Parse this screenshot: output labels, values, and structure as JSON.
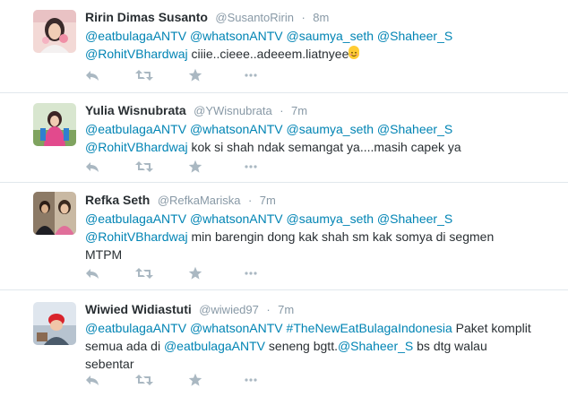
{
  "tweets": [
    {
      "fullname": "Ririn Dimas Susanto",
      "username": "@SusantoRirin",
      "sep": "·",
      "time": "8m",
      "line1": [
        {
          "text": "@eatbulagaANTV",
          "mention": true
        },
        {
          "text": " ",
          "mention": false
        },
        {
          "text": "@whatsonANTV",
          "mention": true
        },
        {
          "text": " ",
          "mention": false
        },
        {
          "text": "@saumya_seth",
          "mention": true
        },
        {
          "text": " ",
          "mention": false
        },
        {
          "text": "@Shaheer_S",
          "mention": true
        }
      ],
      "line2": [
        {
          "text": "@RohitVBhardwaj",
          "mention": true
        },
        {
          "text": " ciiie..cieee..adeeem.liatnyee",
          "mention": false
        }
      ],
      "emoji": "smiling-face-emoji"
    },
    {
      "fullname": "Yulia Wisnubrata",
      "username": "@YWisnubrata",
      "sep": "·",
      "time": "7m",
      "line1": [
        {
          "text": "@eatbulagaANTV",
          "mention": true
        },
        {
          "text": " ",
          "mention": false
        },
        {
          "text": "@whatsonANTV",
          "mention": true
        },
        {
          "text": " ",
          "mention": false
        },
        {
          "text": "@saumya_seth",
          "mention": true
        },
        {
          "text": " ",
          "mention": false
        },
        {
          "text": "@Shaheer_S",
          "mention": true
        }
      ],
      "line2": [
        {
          "text": "@RohitVBhardwaj",
          "mention": true
        },
        {
          "text": " kok si shah ndak semangat ya....masih capek ya",
          "mention": false
        }
      ]
    },
    {
      "fullname": "Refka Seth",
      "username": "@RefkaMariska",
      "sep": "·",
      "time": "7m",
      "line1": [
        {
          "text": "@eatbulagaANTV",
          "mention": true
        },
        {
          "text": " ",
          "mention": false
        },
        {
          "text": "@whatsonANTV",
          "mention": true
        },
        {
          "text": " ",
          "mention": false
        },
        {
          "text": "@saumya_seth",
          "mention": true
        },
        {
          "text": " ",
          "mention": false
        },
        {
          "text": "@Shaheer_S",
          "mention": true
        }
      ],
      "line2": [
        {
          "text": "@RohitVBhardwaj",
          "mention": true
        },
        {
          "text": " min barengin dong kak shah sm kak somya di segmen",
          "mention": false
        }
      ],
      "line3": [
        {
          "text": "MTPM",
          "mention": false
        }
      ]
    },
    {
      "fullname": "Wiwied Widiastuti",
      "username": "@wiwied97",
      "sep": "·",
      "time": "7m",
      "line1": [
        {
          "text": "@eatbulagaANTV",
          "mention": true
        },
        {
          "text": " ",
          "mention": false
        },
        {
          "text": "@whatsonANTV",
          "mention": true
        },
        {
          "text": " ",
          "mention": false
        },
        {
          "text": "#TheNewEatBulagaIndonesia",
          "mention": true
        },
        {
          "text": " Paket komplit",
          "mention": false
        }
      ],
      "line2": [
        {
          "text": "semua ada di ",
          "mention": false
        },
        {
          "text": "@eatbulagaANTV",
          "mention": true
        },
        {
          "text": " seneng bgtt.",
          "mention": false
        },
        {
          "text": "@Shaheer_S",
          "mention": true
        },
        {
          "text": " bs dtg walau",
          "mention": false
        }
      ],
      "line3": [
        {
          "text": "sebentar",
          "mention": false
        }
      ]
    }
  ],
  "actions": {
    "reply_icon": "reply-icon",
    "retweet_icon": "retweet-icon",
    "favorite_icon": "favorite-star-icon",
    "more_icon": "more-dots-icon"
  },
  "colors": {
    "name": "#292f33",
    "meta": "#8899a6",
    "mention": "#0084b4",
    "action_icon": "#aab8c2",
    "divider": "#e1e8ed"
  }
}
